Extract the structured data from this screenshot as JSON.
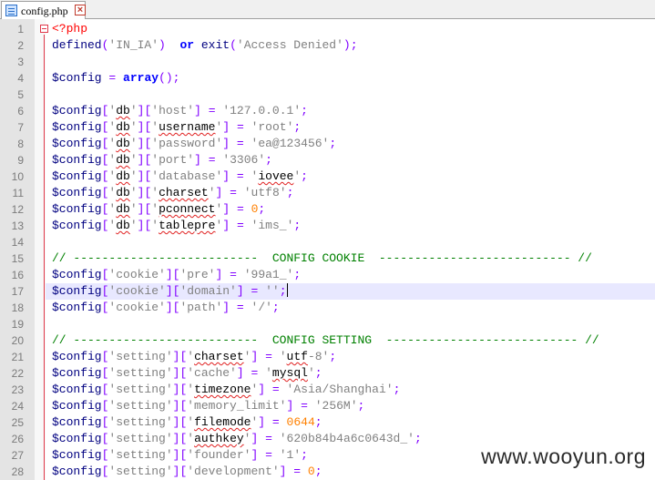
{
  "tab": {
    "title": "config.php"
  },
  "watermark": "www.wooyun.org",
  "lines": [
    {
      "n": "1",
      "t": [
        [
          "php",
          "<?php"
        ]
      ]
    },
    {
      "n": "2",
      "t": [
        [
          "fn",
          "defined"
        ],
        [
          "op",
          "("
        ],
        [
          "str",
          "'IN_IA'"
        ],
        [
          "op",
          ")"
        ],
        [
          "",
          "  "
        ],
        [
          "kw",
          "or"
        ],
        [
          "",
          ""
        ],
        [
          "fn",
          " exit"
        ],
        [
          "op",
          "("
        ],
        [
          "str",
          "'Access Denied'"
        ],
        [
          "op",
          ");"
        ]
      ]
    },
    {
      "n": "3",
      "t": []
    },
    {
      "n": "4",
      "t": [
        [
          "var",
          "$config"
        ],
        [
          "",
          " "
        ],
        [
          "op",
          "="
        ],
        [
          "",
          " "
        ],
        [
          "kw",
          "array"
        ],
        [
          "op",
          "();"
        ]
      ]
    },
    {
      "n": "5",
      "t": []
    },
    {
      "n": "6",
      "t": [
        [
          "var",
          "$config"
        ],
        [
          "op",
          "["
        ],
        [
          "str",
          "'"
        ],
        [
          "sq",
          "db"
        ],
        [
          "str",
          "'"
        ],
        [
          "op",
          "]["
        ],
        [
          "str",
          "'host'"
        ],
        [
          "op",
          "]"
        ],
        [
          "",
          " "
        ],
        [
          "op",
          "="
        ],
        [
          "",
          " "
        ],
        [
          "str",
          "'127.0.0.1'"
        ],
        [
          "op",
          ";"
        ]
      ]
    },
    {
      "n": "7",
      "t": [
        [
          "var",
          "$config"
        ],
        [
          "op",
          "["
        ],
        [
          "str",
          "'"
        ],
        [
          "sq",
          "db"
        ],
        [
          "str",
          "'"
        ],
        [
          "op",
          "]["
        ],
        [
          "str",
          "'"
        ],
        [
          "sq",
          "username"
        ],
        [
          "str",
          "'"
        ],
        [
          "op",
          "]"
        ],
        [
          "",
          " "
        ],
        [
          "op",
          "="
        ],
        [
          "",
          " "
        ],
        [
          "str",
          "'root'"
        ],
        [
          "op",
          ";"
        ]
      ]
    },
    {
      "n": "8",
      "t": [
        [
          "var",
          "$config"
        ],
        [
          "op",
          "["
        ],
        [
          "str",
          "'"
        ],
        [
          "sq",
          "db"
        ],
        [
          "str",
          "'"
        ],
        [
          "op",
          "]["
        ],
        [
          "str",
          "'password'"
        ],
        [
          "op",
          "]"
        ],
        [
          "",
          " "
        ],
        [
          "op",
          "="
        ],
        [
          "",
          " "
        ],
        [
          "str",
          "'ea@123456'"
        ],
        [
          "op",
          ";"
        ]
      ]
    },
    {
      "n": "9",
      "t": [
        [
          "var",
          "$config"
        ],
        [
          "op",
          "["
        ],
        [
          "str",
          "'"
        ],
        [
          "sq",
          "db"
        ],
        [
          "str",
          "'"
        ],
        [
          "op",
          "]["
        ],
        [
          "str",
          "'port'"
        ],
        [
          "op",
          "]"
        ],
        [
          "",
          " "
        ],
        [
          "op",
          "="
        ],
        [
          "",
          " "
        ],
        [
          "str",
          "'3306'"
        ],
        [
          "op",
          ";"
        ]
      ]
    },
    {
      "n": "10",
      "t": [
        [
          "var",
          "$config"
        ],
        [
          "op",
          "["
        ],
        [
          "str",
          "'"
        ],
        [
          "sq",
          "db"
        ],
        [
          "str",
          "'"
        ],
        [
          "op",
          "]["
        ],
        [
          "str",
          "'database'"
        ],
        [
          "op",
          "]"
        ],
        [
          "",
          " "
        ],
        [
          "op",
          "="
        ],
        [
          "",
          " "
        ],
        [
          "str",
          "'"
        ],
        [
          "sq",
          "iovee"
        ],
        [
          "str",
          "'"
        ],
        [
          "op",
          ";"
        ]
      ]
    },
    {
      "n": "11",
      "t": [
        [
          "var",
          "$config"
        ],
        [
          "op",
          "["
        ],
        [
          "str",
          "'"
        ],
        [
          "sq",
          "db"
        ],
        [
          "str",
          "'"
        ],
        [
          "op",
          "]["
        ],
        [
          "str",
          "'"
        ],
        [
          "sq",
          "charset"
        ],
        [
          "str",
          "'"
        ],
        [
          "op",
          "]"
        ],
        [
          "",
          " "
        ],
        [
          "op",
          "="
        ],
        [
          "",
          " "
        ],
        [
          "str",
          "'utf8'"
        ],
        [
          "op",
          ";"
        ]
      ]
    },
    {
      "n": "12",
      "t": [
        [
          "var",
          "$config"
        ],
        [
          "op",
          "["
        ],
        [
          "str",
          "'"
        ],
        [
          "sq",
          "db"
        ],
        [
          "str",
          "'"
        ],
        [
          "op",
          "]["
        ],
        [
          "str",
          "'"
        ],
        [
          "sq",
          "pconnect"
        ],
        [
          "str",
          "'"
        ],
        [
          "op",
          "]"
        ],
        [
          "",
          " "
        ],
        [
          "op",
          "="
        ],
        [
          "",
          " "
        ],
        [
          "num",
          "0"
        ],
        [
          "op",
          ";"
        ]
      ]
    },
    {
      "n": "13",
      "t": [
        [
          "var",
          "$config"
        ],
        [
          "op",
          "["
        ],
        [
          "str",
          "'"
        ],
        [
          "sq",
          "db"
        ],
        [
          "str",
          "'"
        ],
        [
          "op",
          "]["
        ],
        [
          "str",
          "'"
        ],
        [
          "sq",
          "tablepre"
        ],
        [
          "str",
          "'"
        ],
        [
          "op",
          "]"
        ],
        [
          "",
          " "
        ],
        [
          "op",
          "="
        ],
        [
          "",
          " "
        ],
        [
          "str",
          "'ims_'"
        ],
        [
          "op",
          ";"
        ]
      ]
    },
    {
      "n": "14",
      "t": []
    },
    {
      "n": "15",
      "t": [
        [
          "cmt",
          "// --------------------------  CONFIG COOKIE  --------------------------- //"
        ]
      ]
    },
    {
      "n": "16",
      "t": [
        [
          "var",
          "$config"
        ],
        [
          "op",
          "["
        ],
        [
          "str",
          "'cookie'"
        ],
        [
          "op",
          "]["
        ],
        [
          "str",
          "'pre'"
        ],
        [
          "op",
          "]"
        ],
        [
          "",
          " "
        ],
        [
          "op",
          "="
        ],
        [
          "",
          " "
        ],
        [
          "str",
          "'99a1_'"
        ],
        [
          "op",
          ";"
        ]
      ]
    },
    {
      "n": "17",
      "t": [
        [
          "var",
          "$config"
        ],
        [
          "op",
          "["
        ],
        [
          "str",
          "'cookie'"
        ],
        [
          "op",
          "]["
        ],
        [
          "str",
          "'domain'"
        ],
        [
          "op",
          "]"
        ],
        [
          "",
          " "
        ],
        [
          "op",
          "="
        ],
        [
          "",
          " "
        ],
        [
          "str",
          "''"
        ],
        [
          "op",
          ";"
        ]
      ]
    },
    {
      "n": "18",
      "t": [
        [
          "var",
          "$config"
        ],
        [
          "op",
          "["
        ],
        [
          "str",
          "'cookie'"
        ],
        [
          "op",
          "]["
        ],
        [
          "str",
          "'path'"
        ],
        [
          "op",
          "]"
        ],
        [
          "",
          " "
        ],
        [
          "op",
          "="
        ],
        [
          "",
          " "
        ],
        [
          "str",
          "'/'"
        ],
        [
          "op",
          ";"
        ]
      ]
    },
    {
      "n": "19",
      "t": []
    },
    {
      "n": "20",
      "t": [
        [
          "cmt",
          "// --------------------------  CONFIG SETTING  --------------------------- //"
        ]
      ]
    },
    {
      "n": "21",
      "t": [
        [
          "var",
          "$config"
        ],
        [
          "op",
          "["
        ],
        [
          "str",
          "'setting'"
        ],
        [
          "op",
          "]["
        ],
        [
          "str",
          "'"
        ],
        [
          "sq",
          "charset"
        ],
        [
          "str",
          "'"
        ],
        [
          "op",
          "]"
        ],
        [
          "",
          " "
        ],
        [
          "op",
          "="
        ],
        [
          "",
          " "
        ],
        [
          "str",
          "'"
        ],
        [
          "sq",
          "utf"
        ],
        [
          "str",
          "-8'"
        ],
        [
          "op",
          ";"
        ]
      ]
    },
    {
      "n": "22",
      "t": [
        [
          "var",
          "$config"
        ],
        [
          "op",
          "["
        ],
        [
          "str",
          "'setting'"
        ],
        [
          "op",
          "]["
        ],
        [
          "str",
          "'cache'"
        ],
        [
          "op",
          "]"
        ],
        [
          "",
          " "
        ],
        [
          "op",
          "="
        ],
        [
          "",
          " "
        ],
        [
          "str",
          "'"
        ],
        [
          "sq",
          "mysql"
        ],
        [
          "str",
          "'"
        ],
        [
          "op",
          ";"
        ]
      ]
    },
    {
      "n": "23",
      "t": [
        [
          "var",
          "$config"
        ],
        [
          "op",
          "["
        ],
        [
          "str",
          "'setting'"
        ],
        [
          "op",
          "]["
        ],
        [
          "str",
          "'"
        ],
        [
          "sq",
          "timezone"
        ],
        [
          "str",
          "'"
        ],
        [
          "op",
          "]"
        ],
        [
          "",
          " "
        ],
        [
          "op",
          "="
        ],
        [
          "",
          " "
        ],
        [
          "str",
          "'Asia/Shanghai'"
        ],
        [
          "op",
          ";"
        ]
      ]
    },
    {
      "n": "24",
      "t": [
        [
          "var",
          "$config"
        ],
        [
          "op",
          "["
        ],
        [
          "str",
          "'setting'"
        ],
        [
          "op",
          "]["
        ],
        [
          "str",
          "'memory_limit'"
        ],
        [
          "op",
          "]"
        ],
        [
          "",
          " "
        ],
        [
          "op",
          "="
        ],
        [
          "",
          " "
        ],
        [
          "str",
          "'256M'"
        ],
        [
          "op",
          ";"
        ]
      ]
    },
    {
      "n": "25",
      "t": [
        [
          "var",
          "$config"
        ],
        [
          "op",
          "["
        ],
        [
          "str",
          "'setting'"
        ],
        [
          "op",
          "]["
        ],
        [
          "str",
          "'"
        ],
        [
          "sq",
          "filemode"
        ],
        [
          "str",
          "'"
        ],
        [
          "op",
          "]"
        ],
        [
          "",
          " "
        ],
        [
          "op",
          "="
        ],
        [
          "",
          " "
        ],
        [
          "num",
          "0644"
        ],
        [
          "op",
          ";"
        ]
      ]
    },
    {
      "n": "26",
      "t": [
        [
          "var",
          "$config"
        ],
        [
          "op",
          "["
        ],
        [
          "str",
          "'setting'"
        ],
        [
          "op",
          "]["
        ],
        [
          "str",
          "'"
        ],
        [
          "sq",
          "authkey"
        ],
        [
          "str",
          "'"
        ],
        [
          "op",
          "]"
        ],
        [
          "",
          " "
        ],
        [
          "op",
          "="
        ],
        [
          "",
          " "
        ],
        [
          "str",
          "'620b84b4a6c0643d_'"
        ],
        [
          "op",
          ";"
        ]
      ]
    },
    {
      "n": "27",
      "t": [
        [
          "var",
          "$config"
        ],
        [
          "op",
          "["
        ],
        [
          "str",
          "'setting'"
        ],
        [
          "op",
          "]["
        ],
        [
          "str",
          "'founder'"
        ],
        [
          "op",
          "]"
        ],
        [
          "",
          " "
        ],
        [
          "op",
          "="
        ],
        [
          "",
          " "
        ],
        [
          "str",
          "'1'"
        ],
        [
          "op",
          ";"
        ]
      ]
    },
    {
      "n": "28",
      "t": [
        [
          "var",
          "$config"
        ],
        [
          "op",
          "["
        ],
        [
          "str",
          "'setting'"
        ],
        [
          "op",
          "]["
        ],
        [
          "str",
          "'development'"
        ],
        [
          "op",
          "]"
        ],
        [
          "",
          " "
        ],
        [
          "op",
          "="
        ],
        [
          "",
          " "
        ],
        [
          "num",
          "0"
        ],
        [
          "op",
          ";"
        ]
      ]
    }
  ]
}
